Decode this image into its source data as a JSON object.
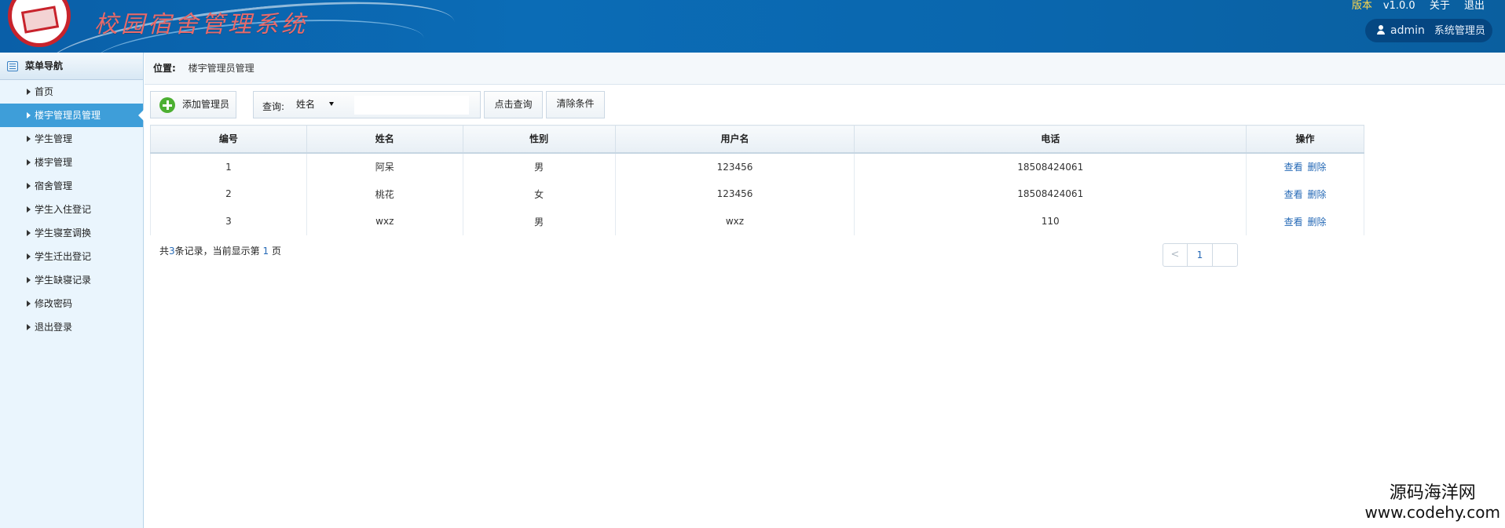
{
  "header": {
    "app_title": "校园宿舍管理系统",
    "version_label": "版本",
    "version": "v1.0.0",
    "about": "关于",
    "logout": "退出",
    "username": "admin",
    "role": "系统管理员"
  },
  "sidebar": {
    "title": "菜单导航",
    "items": [
      {
        "label": "首页"
      },
      {
        "label": "楼宇管理员管理"
      },
      {
        "label": "学生管理"
      },
      {
        "label": "楼宇管理"
      },
      {
        "label": "宿舍管理"
      },
      {
        "label": "学生入住登记"
      },
      {
        "label": "学生寝室调换"
      },
      {
        "label": "学生迁出登记"
      },
      {
        "label": "学生缺寝记录"
      },
      {
        "label": "修改密码"
      },
      {
        "label": "退出登录"
      }
    ],
    "active_index": 1
  },
  "location": {
    "label": "位置:",
    "value": "楼宇管理员管理"
  },
  "toolbar": {
    "add_label": "添加管理员",
    "query_label": "查询:",
    "field_selected": "姓名",
    "search_value": "",
    "query_button": "点击查询",
    "clear_button": "清除条件"
  },
  "table": {
    "columns": [
      "编号",
      "姓名",
      "性别",
      "用户名",
      "电话",
      "操作"
    ],
    "rows": [
      {
        "id": "1",
        "name": "阿呆",
        "gender": "男",
        "username": "123456",
        "phone": "18508424061",
        "view": "查看",
        "delete": "删除"
      },
      {
        "id": "2",
        "name": "桃花",
        "gender": "女",
        "username": "123456",
        "phone": "18508424061",
        "view": "查看",
        "delete": "删除"
      },
      {
        "id": "3",
        "name": "wxz",
        "gender": "男",
        "username": "wxz",
        "phone": "110",
        "view": "查看",
        "delete": "删除"
      }
    ]
  },
  "summary": {
    "prefix": "共",
    "total": "3",
    "mid": "条记录，当前显示第",
    "page": "1",
    "suffix": "页"
  },
  "pager": {
    "prev": "<",
    "current": "1",
    "next": ""
  },
  "watermark": {
    "line1": "源码海洋网",
    "line2": "www.codehy.com"
  }
}
